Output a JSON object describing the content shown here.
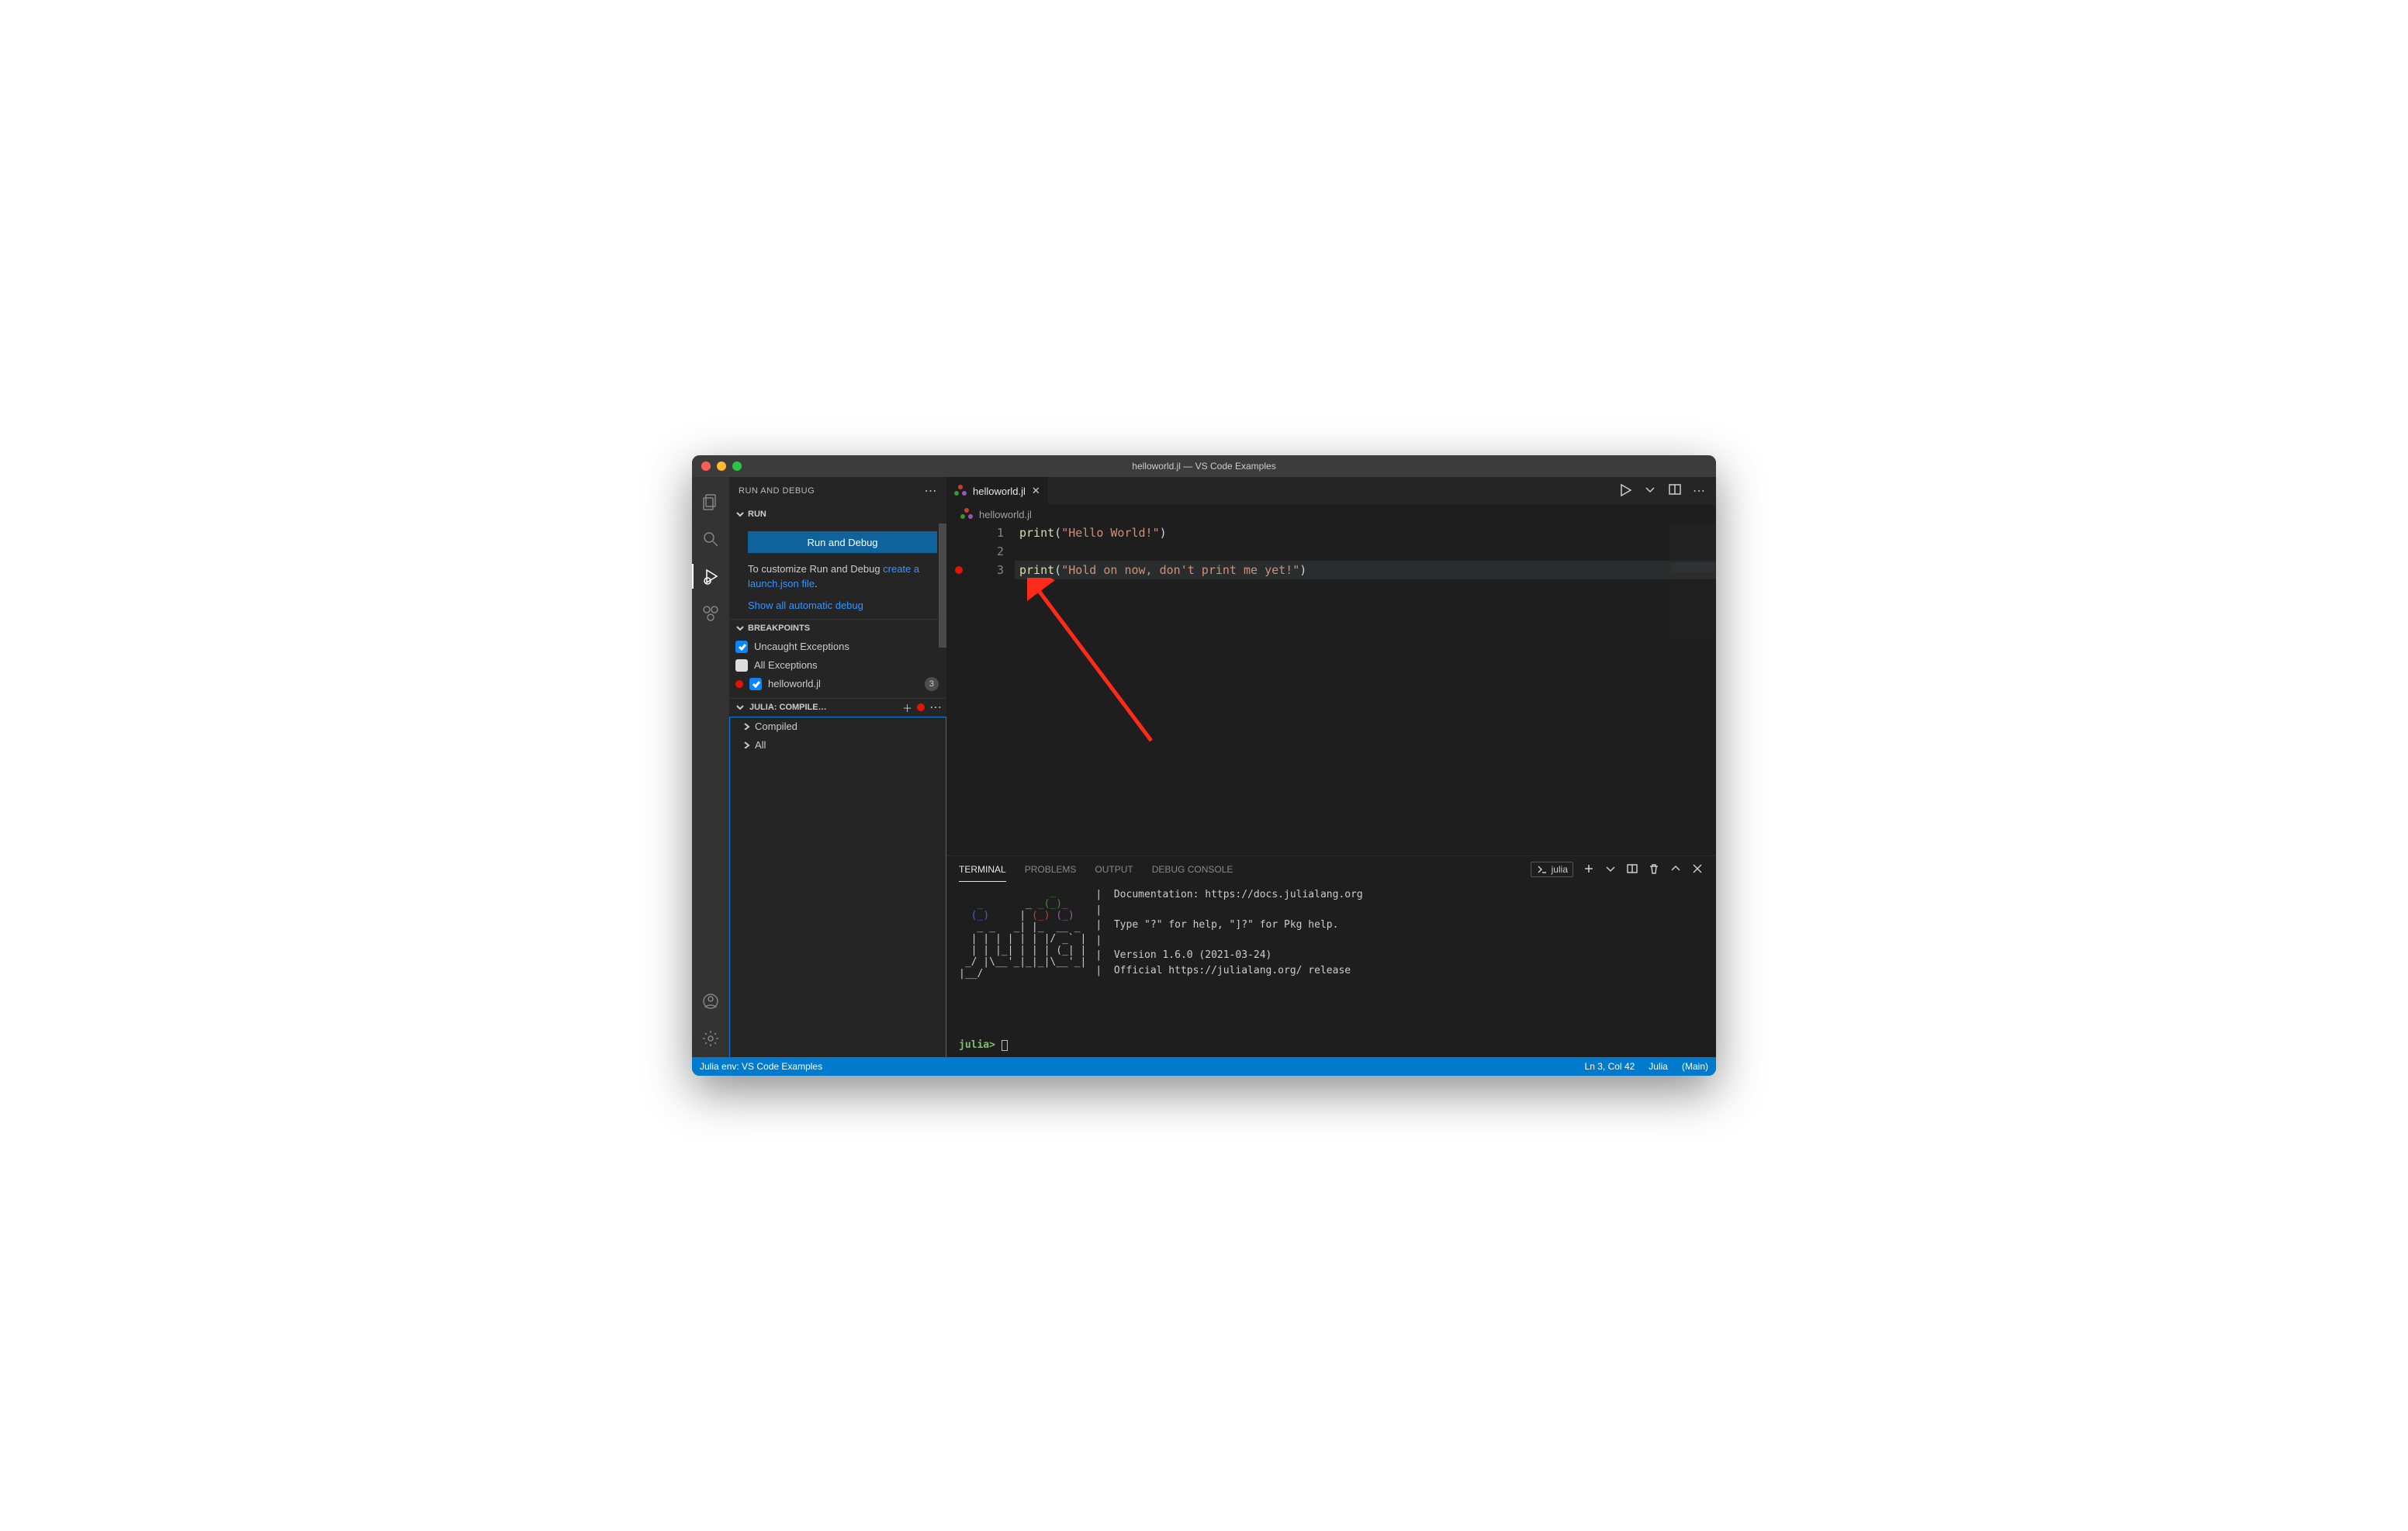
{
  "window": {
    "title": "helloworld.jl — VS Code Examples"
  },
  "sidebar": {
    "title": "RUN AND DEBUG",
    "run_section": {
      "label": "RUN",
      "button": "Run and Debug",
      "text1": "To customize Run and Debug ",
      "link1": "create a launch.json file",
      "period": ".",
      "show_all": "Show all automatic debug"
    },
    "breakpoints": {
      "label": "BREAKPOINTS",
      "items": [
        {
          "label": "Uncaught Exceptions",
          "checked": true,
          "kind": "cb"
        },
        {
          "label": "All Exceptions",
          "checked": false,
          "kind": "cb"
        },
        {
          "label": "helloworld.jl",
          "checked": true,
          "kind": "bp",
          "line_badge": "3"
        }
      ]
    },
    "julia_compiled": {
      "label": "JULIA: COMPILE…",
      "items": [
        {
          "label": "Compiled"
        },
        {
          "label": "All"
        }
      ]
    }
  },
  "tabs": {
    "active": {
      "filename": "helloworld.jl"
    }
  },
  "breadcrumb": {
    "filename": "helloworld.jl"
  },
  "editor": {
    "lines": [
      {
        "num": "1",
        "bp": false,
        "hl": false,
        "fn": "print",
        "open": "(",
        "str": "\"Hello World!\"",
        "close": ")"
      },
      {
        "num": "2",
        "bp": false,
        "hl": false
      },
      {
        "num": "3",
        "bp": true,
        "hl": true,
        "fn": "print",
        "open": "(",
        "str": "\"Hold on now, don't print me yet!\"",
        "close": ")"
      }
    ]
  },
  "panel": {
    "tabs": {
      "terminal": "TERMINAL",
      "problems": "PROBLEMS",
      "output": "OUTPUT",
      "debug": "DEBUG CONSOLE"
    },
    "term_name": "julia",
    "julia_banner": {
      "doc": "|  Documentation: https://docs.julialang.org",
      "blank": "|",
      "help": "|  Type \"?\" for help, \"]?\" for Pkg help.",
      "version": "|  Version 1.6.0 (2021-03-24)",
      "release": "|  Official https://julialang.org/ release"
    },
    "prompt": "julia>"
  },
  "statusbar": {
    "env": "Julia env: VS Code Examples",
    "pos": "Ln 3, Col 42",
    "lang": "Julia",
    "branch": "(Main)"
  }
}
